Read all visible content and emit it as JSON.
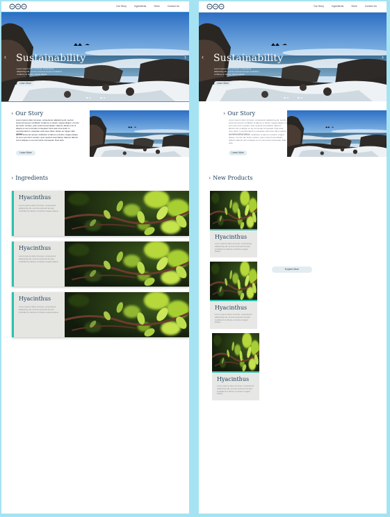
{
  "nav": {
    "links": [
      "Our Story",
      "Ingredients",
      "Store",
      "Contact Us"
    ]
  },
  "hero": {
    "title": "Sustainability",
    "body": "Lorem ipsum dolor sit amet, consectetur adipiscing elit, sed do eiusmod tempor incididunt ut labore et dolore magna aliqua.",
    "button": "Learn More"
  },
  "story": {
    "title": "Our Story",
    "para1": "Lorem ipsum dolor sit amet, consectetur adipiscing elit, sed do eiusmod tempor incididunt ut labore et dolore magna aliqua. Ut enim ad minim veniam, quis nostrud exercitation ullamco laboris nisi ut aliquip ex ea commodo consequat. Duis aute irure dolor in reprehenderit in voluptate velit esse cillum dolore eu fugiat nulla pariatur.",
    "para2": "sed do eiusmod tempor incididunt ut labore et dolore magna aliqua. Ut enim ad minim veniam, quis nostrud exercitation ullamco laboris nisi ut aliquip ex ea commodo consequat. Duis aute.",
    "button": "Learn More"
  },
  "ingredients": {
    "title": "Ingredients",
    "items": [
      {
        "name": "Hyacinthus",
        "desc": "Lorem ipsum dolor sit amet, consectetur adipiscing elit, sed do eiusmod tempor incididunt ut labore et dolore magna aliqua."
      },
      {
        "name": "Hyacinthus",
        "desc": "Lorem ipsum dolor sit amet, consectetur adipiscing elit, sed do eiusmod tempor incididunt ut labore et dolore magna aliqua."
      },
      {
        "name": "Hyacinthus",
        "desc": "Lorem ipsum dolor sit amet, consectetur adipiscing elit, sed do eiusmod tempor incididunt ut labore et dolore magna aliqua."
      }
    ]
  },
  "products": {
    "title": "New Products",
    "explore": "Explore More",
    "items": [
      {
        "name": "Hyacinthus",
        "desc": "Lorem ipsum dolor sit amet, consectetur adipiscing elit, sed do eiusmod tempor incididunt ut labore et dolore magna aliqua."
      },
      {
        "name": "Hyacinthus",
        "desc": "Lorem ipsum dolor sit amet, consectetur adipiscing elit, sed do eiusmod tempor incididunt ut labore et dolore magna aliqua."
      },
      {
        "name": "Hyacinthus",
        "desc": "Lorem ipsum dolor sit amet, consectetur adipiscing elit, sed do eiusmod tempor incididunt ut labore et dolore magna aliqua."
      }
    ]
  },
  "colors": {
    "background": "#a6e3f2",
    "accent": "#2fbfae",
    "heading": "#1c3a57",
    "selection": "#3a97d4"
  },
  "icons": [
    "logo-mark",
    "chevron-right-icon",
    "chevron-left-icon"
  ]
}
